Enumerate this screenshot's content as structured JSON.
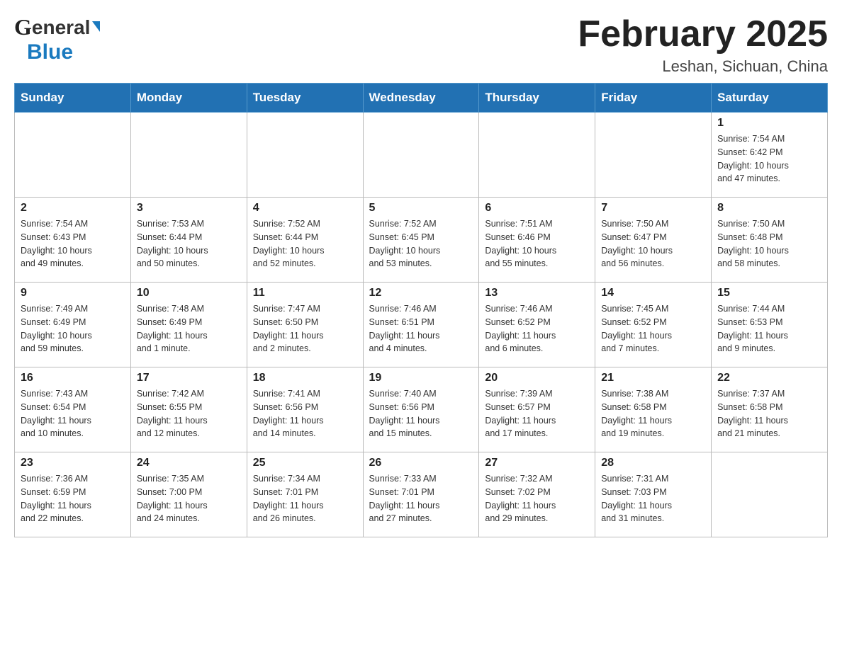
{
  "logo": {
    "line1": "General",
    "line2": "Blue"
  },
  "title": {
    "month_year": "February 2025",
    "location": "Leshan, Sichuan, China"
  },
  "days_of_week": [
    "Sunday",
    "Monday",
    "Tuesday",
    "Wednesday",
    "Thursday",
    "Friday",
    "Saturday"
  ],
  "weeks": [
    [
      {
        "day": "",
        "info": ""
      },
      {
        "day": "",
        "info": ""
      },
      {
        "day": "",
        "info": ""
      },
      {
        "day": "",
        "info": ""
      },
      {
        "day": "",
        "info": ""
      },
      {
        "day": "",
        "info": ""
      },
      {
        "day": "1",
        "info": "Sunrise: 7:54 AM\nSunset: 6:42 PM\nDaylight: 10 hours\nand 47 minutes."
      }
    ],
    [
      {
        "day": "2",
        "info": "Sunrise: 7:54 AM\nSunset: 6:43 PM\nDaylight: 10 hours\nand 49 minutes."
      },
      {
        "day": "3",
        "info": "Sunrise: 7:53 AM\nSunset: 6:44 PM\nDaylight: 10 hours\nand 50 minutes."
      },
      {
        "day": "4",
        "info": "Sunrise: 7:52 AM\nSunset: 6:44 PM\nDaylight: 10 hours\nand 52 minutes."
      },
      {
        "day": "5",
        "info": "Sunrise: 7:52 AM\nSunset: 6:45 PM\nDaylight: 10 hours\nand 53 minutes."
      },
      {
        "day": "6",
        "info": "Sunrise: 7:51 AM\nSunset: 6:46 PM\nDaylight: 10 hours\nand 55 minutes."
      },
      {
        "day": "7",
        "info": "Sunrise: 7:50 AM\nSunset: 6:47 PM\nDaylight: 10 hours\nand 56 minutes."
      },
      {
        "day": "8",
        "info": "Sunrise: 7:50 AM\nSunset: 6:48 PM\nDaylight: 10 hours\nand 58 minutes."
      }
    ],
    [
      {
        "day": "9",
        "info": "Sunrise: 7:49 AM\nSunset: 6:49 PM\nDaylight: 10 hours\nand 59 minutes."
      },
      {
        "day": "10",
        "info": "Sunrise: 7:48 AM\nSunset: 6:49 PM\nDaylight: 11 hours\nand 1 minute."
      },
      {
        "day": "11",
        "info": "Sunrise: 7:47 AM\nSunset: 6:50 PM\nDaylight: 11 hours\nand 2 minutes."
      },
      {
        "day": "12",
        "info": "Sunrise: 7:46 AM\nSunset: 6:51 PM\nDaylight: 11 hours\nand 4 minutes."
      },
      {
        "day": "13",
        "info": "Sunrise: 7:46 AM\nSunset: 6:52 PM\nDaylight: 11 hours\nand 6 minutes."
      },
      {
        "day": "14",
        "info": "Sunrise: 7:45 AM\nSunset: 6:52 PM\nDaylight: 11 hours\nand 7 minutes."
      },
      {
        "day": "15",
        "info": "Sunrise: 7:44 AM\nSunset: 6:53 PM\nDaylight: 11 hours\nand 9 minutes."
      }
    ],
    [
      {
        "day": "16",
        "info": "Sunrise: 7:43 AM\nSunset: 6:54 PM\nDaylight: 11 hours\nand 10 minutes."
      },
      {
        "day": "17",
        "info": "Sunrise: 7:42 AM\nSunset: 6:55 PM\nDaylight: 11 hours\nand 12 minutes."
      },
      {
        "day": "18",
        "info": "Sunrise: 7:41 AM\nSunset: 6:56 PM\nDaylight: 11 hours\nand 14 minutes."
      },
      {
        "day": "19",
        "info": "Sunrise: 7:40 AM\nSunset: 6:56 PM\nDaylight: 11 hours\nand 15 minutes."
      },
      {
        "day": "20",
        "info": "Sunrise: 7:39 AM\nSunset: 6:57 PM\nDaylight: 11 hours\nand 17 minutes."
      },
      {
        "day": "21",
        "info": "Sunrise: 7:38 AM\nSunset: 6:58 PM\nDaylight: 11 hours\nand 19 minutes."
      },
      {
        "day": "22",
        "info": "Sunrise: 7:37 AM\nSunset: 6:58 PM\nDaylight: 11 hours\nand 21 minutes."
      }
    ],
    [
      {
        "day": "23",
        "info": "Sunrise: 7:36 AM\nSunset: 6:59 PM\nDaylight: 11 hours\nand 22 minutes."
      },
      {
        "day": "24",
        "info": "Sunrise: 7:35 AM\nSunset: 7:00 PM\nDaylight: 11 hours\nand 24 minutes."
      },
      {
        "day": "25",
        "info": "Sunrise: 7:34 AM\nSunset: 7:01 PM\nDaylight: 11 hours\nand 26 minutes."
      },
      {
        "day": "26",
        "info": "Sunrise: 7:33 AM\nSunset: 7:01 PM\nDaylight: 11 hours\nand 27 minutes."
      },
      {
        "day": "27",
        "info": "Sunrise: 7:32 AM\nSunset: 7:02 PM\nDaylight: 11 hours\nand 29 minutes."
      },
      {
        "day": "28",
        "info": "Sunrise: 7:31 AM\nSunset: 7:03 PM\nDaylight: 11 hours\nand 31 minutes."
      },
      {
        "day": "",
        "info": ""
      }
    ]
  ]
}
